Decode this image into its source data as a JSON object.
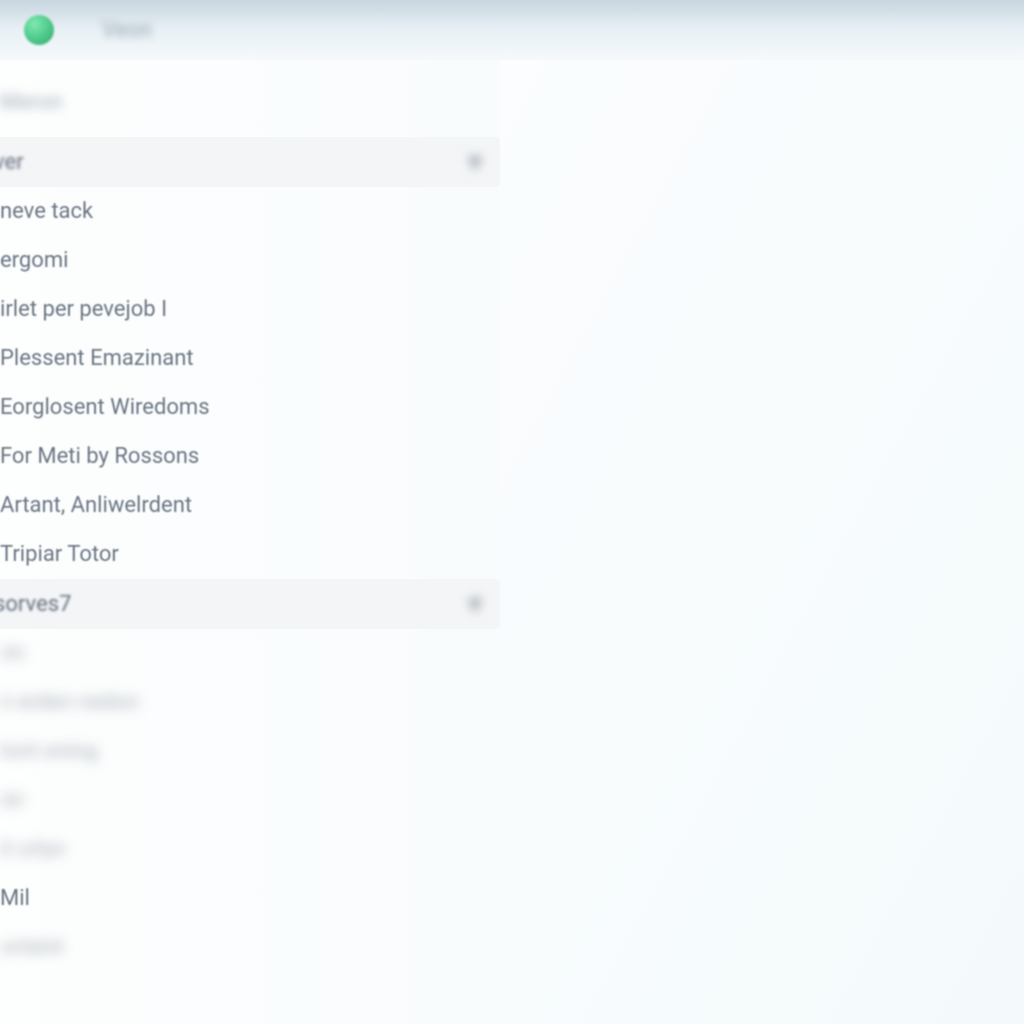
{
  "topbar": {
    "icon_name": "app-badge",
    "label": "Veon"
  },
  "sidebar": {
    "section_title": "Meron",
    "group_a": {
      "label": "ver",
      "caret_glyph": "▾"
    },
    "items_a": [
      "neve tack",
      "ergomi",
      "irlet per pevejob I",
      "Plessent Emazinant",
      "Eorglosent Wiredoms",
      "For Meti by Rossons",
      "Artant, Anliwelrdent",
      "Tripiar Totor"
    ],
    "group_b": {
      "label": "sorves7",
      "caret_glyph": "▾"
    },
    "items_b": [
      "rin",
      "n erden nedon",
      "tont ening",
      "nir",
      "it orlyn",
      "Mil",
      "orteint"
    ]
  }
}
